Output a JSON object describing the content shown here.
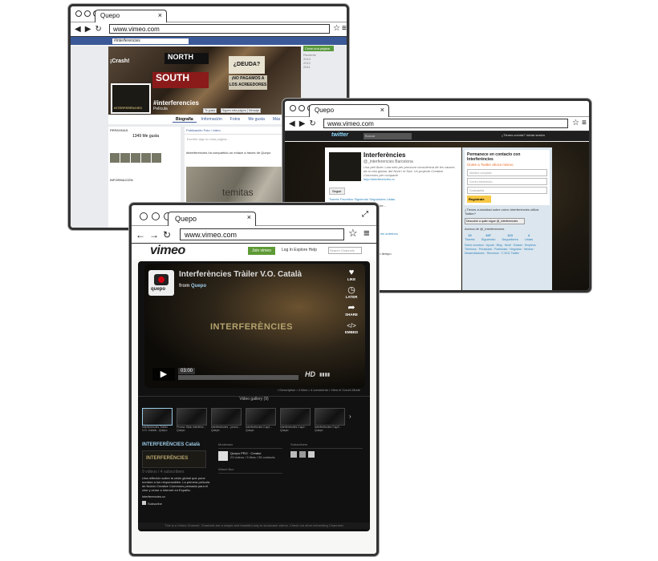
{
  "facebook": {
    "tab_title": "Quepo",
    "url": "www.vimeo.com",
    "search": "#interferencies",
    "page_name": "#interferencies",
    "page_type": "Película",
    "cover_text": [
      "¡Crash!",
      "NORTH",
      "SOUTH",
      "¿DEUDA?",
      "¡NO PAGAMOS A LOS ACREEDORES"
    ],
    "buttons": [
      "Te gusta",
      "Sigues esta página",
      "Mensaje"
    ],
    "tabs": [
      "Biografía",
      "Información",
      "Fotos",
      "Me gusta",
      "Más"
    ],
    "create_page": "Crear una página",
    "years": [
      "Reciente",
      "2013",
      "2012",
      "2011"
    ],
    "likes_label": "PERSONAS",
    "likes": "1349 Me gusta",
    "info_label": "INFORMACIÓN",
    "publish_tabs": "Publicación   Foto / vídeo",
    "publish_placeholder": "Escribe algo en esta página...",
    "post_text": "#interferencies ha compartido un enlace a través de Quepo",
    "post_image_text": "temitas"
  },
  "twitter": {
    "tab_title": "Quepo",
    "url": "www.vimeo.com",
    "search": "Buscar",
    "login": "¿Tienes cuenta?  Iniciar sesión",
    "name": "Interferències",
    "handle": "@_interferencies  Barcelona",
    "bio": "Una peli lliure i una web per provocar consciència de les causes de la crisi global, del Nord i el Sud. Un projecte Creative Commons per compartir.",
    "link": "http://interferencies.cc",
    "follow": "Seguir",
    "tabs": "Tweets   Favoritos   Siguiendo   Seguidores   Listas",
    "tweet_1": "rediu sense fi la crisi. Amb la peli lliure...",
    "tweet_2": "#interferencies ... temps de reveure els anteriors",
    "tweet_3": "...trevido que he conocido en mucho tiempo",
    "signup_title": "Permanece en contacto con Interferències",
    "signup_sub": "Únete a Twitter ahora mismo",
    "fields": [
      "Nombre completo",
      "Correo electrónico",
      "Contraseña"
    ],
    "register": "Regístrate",
    "question": "¿Tienes curiosidad sobre cómo Interferències utiliza Twitter?",
    "question_btn": "Descubre a quién sigue @_interferencies",
    "about": "Acerca de @_interferencies",
    "stats": [
      {
        "n": "13",
        "l": "Tweets"
      },
      {
        "n": "347",
        "l": "Siguiendo"
      },
      {
        "n": "113",
        "l": "Seguidores"
      },
      {
        "n": "4",
        "l": "Listas"
      }
    ],
    "footer": "Sobre nosotros · Ayuda · Blog · Móvil · Estado · Empleos · Términos · Privacidad · Publicidad · Negocios · Medios · Desarrolladores · Recursos · © 2011 Twitter"
  },
  "vimeo": {
    "tab_title": "Quepo",
    "url": "www.vimeo.com",
    "logo": "vimeo",
    "join": "Join vimeo",
    "nav": "Log In    Explore    Help",
    "search": "Search Channels",
    "video_title": "Interferències Tràiler V.O. Català",
    "from_label": "from",
    "from_user": "Quepo",
    "avatar_text": "quepo",
    "side_actions": [
      {
        "icon": "♥",
        "label": "LIKE"
      },
      {
        "icon": "◷",
        "label": "LATER"
      },
      {
        "icon": "➦",
        "label": "SHARE"
      },
      {
        "icon": "</>",
        "label": "EMBED"
      }
    ],
    "overlay_title": "INTERFERÈNCIES",
    "time": "03:00",
    "hd": "HD",
    "meta": "• Description   • 4 likes   • 4 comments   • View in Couch Mode",
    "gallery": "Video gallery (9)",
    "thumbs": [
      "Interferències Tràiler V.O. Català - Quepo",
      "Promo: Blok Interfèrix - Quepo",
      "Interferències - promo - Quepo",
      "Interferències Cap1 - Quepo",
      "Interferències Cap2 - Quepo",
      "Interferències Cap3 - Quepo"
    ],
    "channel_title": "INTERFERÈNCIES Català",
    "channel_img": "INTERFERÈNCIES",
    "channel_stats": "9 videos / 4 subscribers",
    "channel_desc": "Una reflexión sobre la crisis global que pone nombre a los responsables. La primera película de ficción Creative Commons pensada para el cine y verse a Internet en España.",
    "channel_link": "interferencies.cc",
    "subscribe": "Subscribe",
    "moderator_label": "Moderator",
    "moderator": "Quepo  PRO  · Creator",
    "moderator_stats": "23 videos / 5 likes / 55 contacts",
    "wheel_label": "Wheel Box",
    "subscribers_label": "Subscribers",
    "footer": "This is a Vimeo Channel. Channels are a simple and beautiful way to showcase videos. Check out other interesting Channels!"
  }
}
